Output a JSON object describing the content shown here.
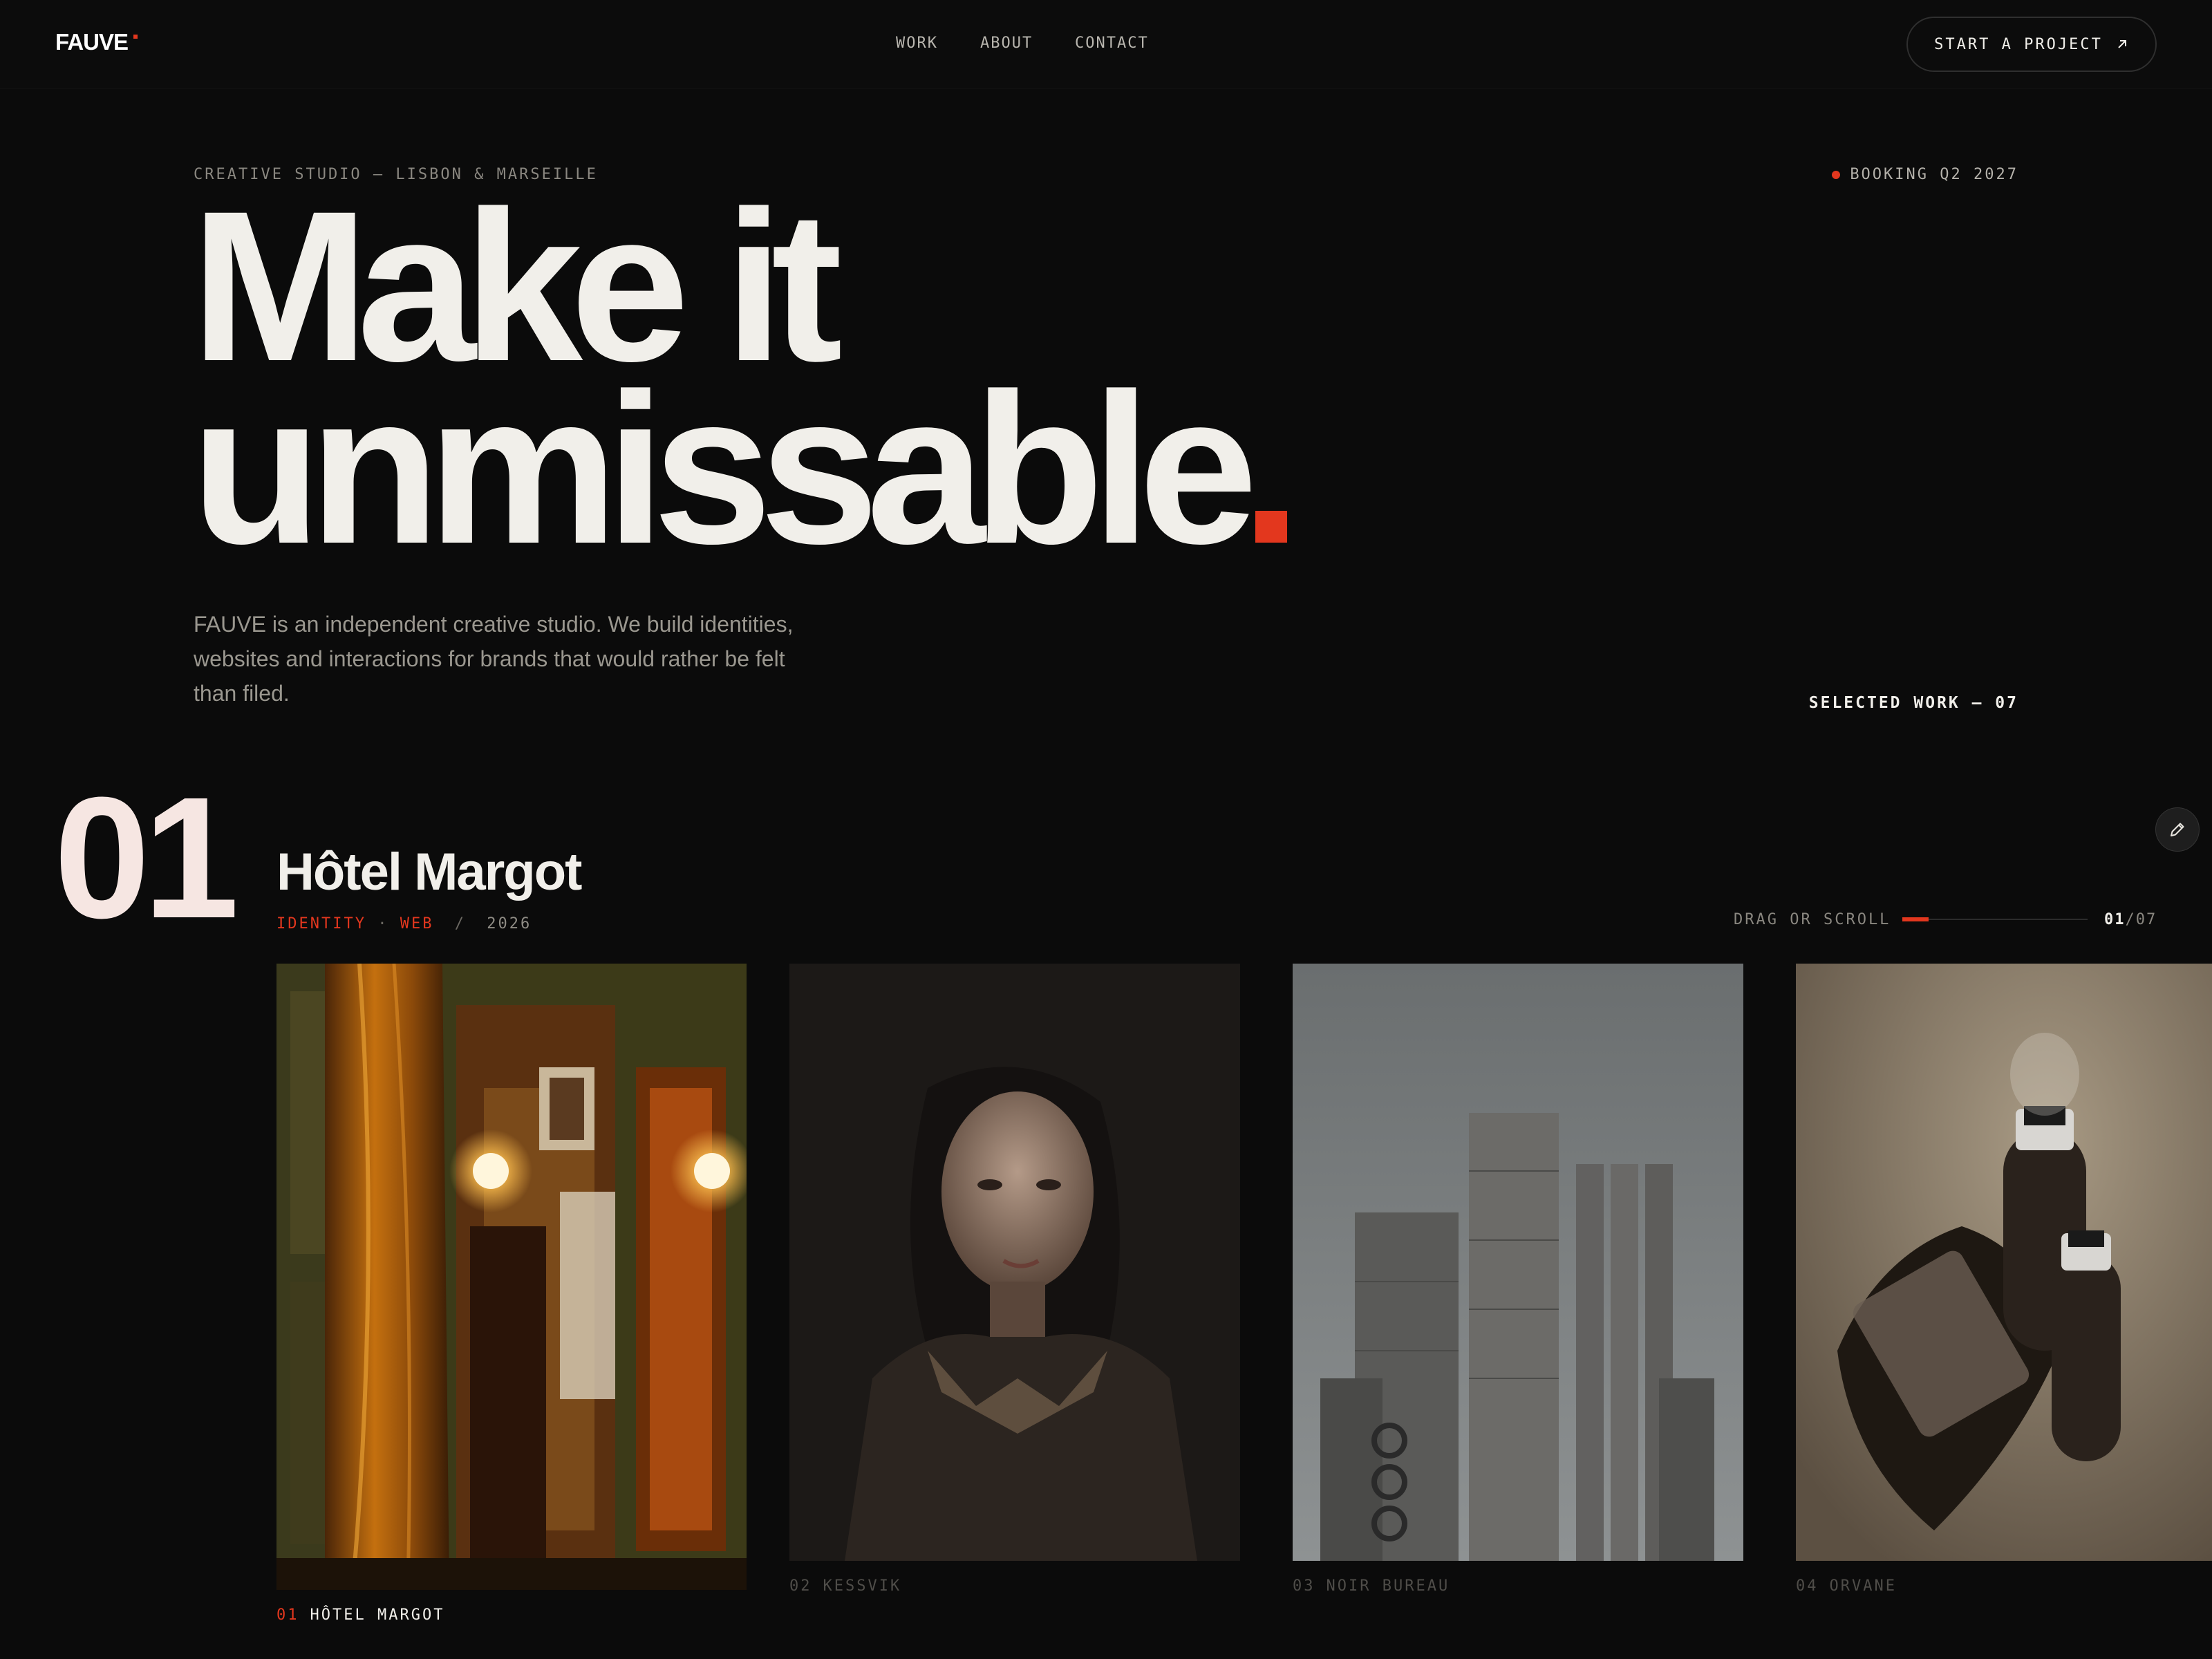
{
  "header": {
    "logo": "FAUVE",
    "nav": [
      "WORK",
      "ABOUT",
      "CONTACT"
    ],
    "cta_label": "START A PROJECT"
  },
  "hero": {
    "eyebrow": "CREATIVE STUDIO — LISBON & MARSEILLE",
    "booking": "BOOKING Q2 2027",
    "headline_line1": "Make it",
    "headline_line2": "unmissable",
    "intro": "FAUVE is an independent creative studio. We build identities, websites and interactions for brands that would rather be felt than filed.",
    "selected_work": "SELECTED WORK — 07"
  },
  "project": {
    "number": "01",
    "title": "Hôtel Margot",
    "tags": [
      "IDENTITY",
      "WEB"
    ],
    "separator": "/",
    "year": "2026"
  },
  "carousel": {
    "hint": "DRAG OR SCROLL",
    "current": "01",
    "total": "/07",
    "progress": 0.14
  },
  "cards": [
    {
      "num": "01",
      "title": "HÔTEL MARGOT",
      "icon": "hotel-interior-photo"
    },
    {
      "num": "02",
      "title": "KESSVIK",
      "icon": "portrait-photo"
    },
    {
      "num": "03",
      "title": "NOIR BUREAU",
      "icon": "brutalist-building-photo"
    },
    {
      "num": "04",
      "title": "ORVANE",
      "icon": "perfume-bottles-photo"
    }
  ],
  "colors": {
    "background": "#0b0b0b",
    "accent": "#e3371e",
    "text": "#f1efea",
    "muted": "#8a8780"
  }
}
